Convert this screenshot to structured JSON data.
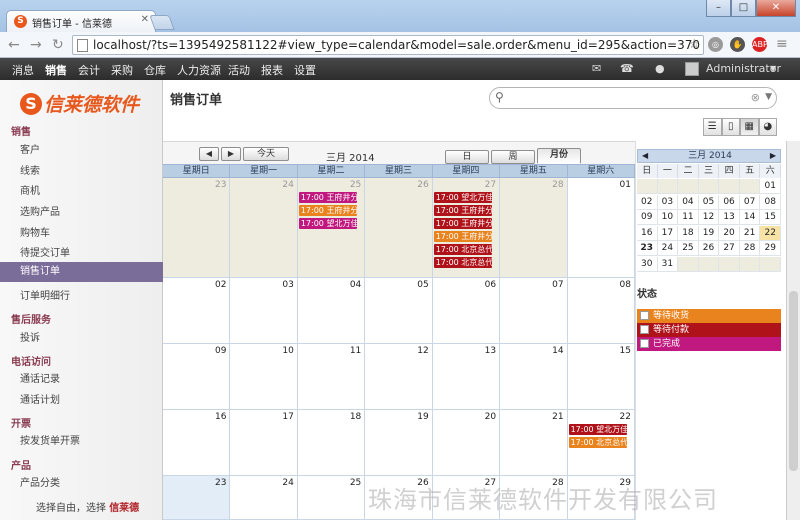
{
  "browser": {
    "tab_title": "销售订单 - 信莱德",
    "tab_icon": "S",
    "url": "localhost/?ts=1395492581122#view_type=calendar&model=sale.order&menu_id=295&action=370",
    "ext_abp": "ABP"
  },
  "topmenu": {
    "items": [
      "消息",
      "销售",
      "会计",
      "采购",
      "仓库",
      "人力资源",
      "活动",
      "报表",
      "设置"
    ],
    "active": "销售",
    "user": "Administrator"
  },
  "sidebar": {
    "logo_letter": "S",
    "logo_text": "信莱德软件",
    "sections": [
      {
        "title": "销售",
        "items": [
          "客户",
          "线索",
          "商机",
          "选购产品",
          "购物车",
          "待提交订单",
          "销售订单",
          "订单明细行"
        ]
      },
      {
        "title": "售后服务",
        "items": [
          "投诉"
        ]
      },
      {
        "title": "电话访问",
        "items": [
          "通话记录",
          "通话计划"
        ]
      },
      {
        "title": "开票",
        "items": [
          "按发货单开票"
        ]
      },
      {
        "title": "产品",
        "items": [
          "产品分类"
        ]
      }
    ],
    "selected": "销售订单",
    "footer_text": "选择自由，选择",
    "footer_brand": "信莱德"
  },
  "main": {
    "title": "销售订单",
    "search_placeholder": ""
  },
  "calendar": {
    "today_label": "今天",
    "month_title": "三月 2014",
    "view_day": "日",
    "view_week": "周",
    "view_month": "月份",
    "weekdays": [
      "星期日",
      "星期一",
      "星期二",
      "星期三",
      "星期四",
      "星期五",
      "星期六"
    ],
    "weeks": [
      [
        "23",
        "24",
        "25",
        "26",
        "27",
        "28",
        "01"
      ],
      [
        "02",
        "03",
        "04",
        "05",
        "06",
        "07",
        "08"
      ],
      [
        "09",
        "10",
        "11",
        "12",
        "13",
        "14",
        "15"
      ],
      [
        "16",
        "17",
        "18",
        "19",
        "20",
        "21",
        "22"
      ],
      [
        "23",
        "24",
        "25",
        "26",
        "27",
        "28",
        "29"
      ]
    ],
    "events": [
      {
        "week": 0,
        "day": 2,
        "slot": 0,
        "text": "17:00 王府井分",
        "color": "#c0187e"
      },
      {
        "week": 0,
        "day": 2,
        "slot": 1,
        "text": "17:00 王府井分",
        "color": "#e8831e"
      },
      {
        "week": 0,
        "day": 2,
        "slot": 2,
        "text": "17:00 望北万佳",
        "color": "#c0187e"
      },
      {
        "week": 0,
        "day": 4,
        "slot": 0,
        "text": "17:00 望北万佳",
        "color": "#b0121a"
      },
      {
        "week": 0,
        "day": 4,
        "slot": 1,
        "text": "17:00 王府井分",
        "color": "#b0121a"
      },
      {
        "week": 0,
        "day": 4,
        "slot": 2,
        "text": "17:00 王府井分",
        "color": "#b0121a"
      },
      {
        "week": 0,
        "day": 4,
        "slot": 3,
        "text": "17:00 王府井分",
        "color": "#e8831e"
      },
      {
        "week": 0,
        "day": 4,
        "slot": 4,
        "text": "17:00 北京总代",
        "color": "#b0121a"
      },
      {
        "week": 0,
        "day": 4,
        "slot": 5,
        "text": "17:00 北京总代",
        "color": "#b0121a"
      },
      {
        "week": 3,
        "day": 6,
        "slot": 0,
        "text": "17:00 望北万佳",
        "color": "#b0121a"
      },
      {
        "week": 3,
        "day": 6,
        "slot": 1,
        "text": "17:00 北京总代",
        "color": "#e8831e"
      }
    ]
  },
  "minical": {
    "title": "三月 2014",
    "weekdays": [
      "日",
      "一",
      "二",
      "三",
      "四",
      "五",
      "六"
    ],
    "rows": [
      [
        "",
        "",
        "",
        "",
        "",
        "",
        "01"
      ],
      [
        "02",
        "03",
        "04",
        "05",
        "06",
        "07",
        "08"
      ],
      [
        "09",
        "10",
        "11",
        "12",
        "13",
        "14",
        "15"
      ],
      [
        "16",
        "17",
        "18",
        "19",
        "20",
        "21",
        "22"
      ],
      [
        "23",
        "24",
        "25",
        "26",
        "27",
        "28",
        "29"
      ],
      [
        "30",
        "31",
        "",
        "",
        "",
        "",
        ""
      ]
    ],
    "today": "23",
    "selected": "22"
  },
  "states": {
    "title": "状态",
    "items": [
      {
        "label": "等待收货",
        "color": "#e8831e"
      },
      {
        "label": "等待付款",
        "color": "#b0121a"
      },
      {
        "label": "已完成",
        "color": "#c0187e"
      }
    ]
  },
  "watermark": "珠海市信莱德软件开发有限公司"
}
